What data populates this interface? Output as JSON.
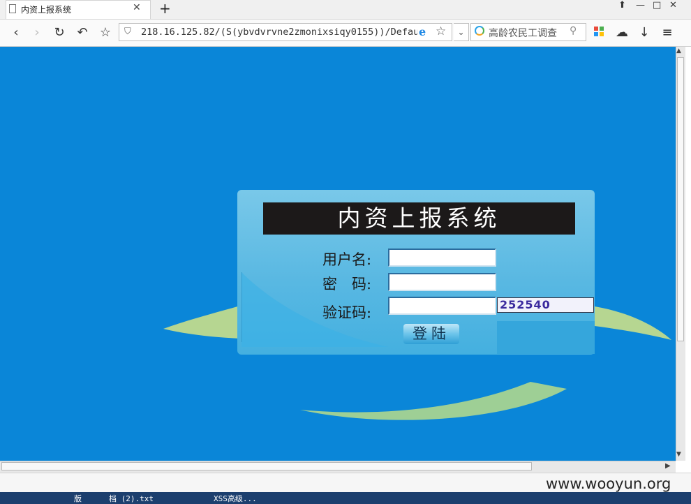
{
  "browser": {
    "tab_title": "内资上报系统",
    "url": "218.16.125.82/(S(ybvdvrvne2zmonixsiqy0155))/Defau",
    "search_text": "高龄农民工调查"
  },
  "login": {
    "title": "内资上报系统",
    "username_label": "用户名:",
    "password_label": "密　码:",
    "captcha_label": "验证码:",
    "captcha_value": "252540",
    "submit_label": "登陆"
  },
  "statusbar": {
    "watermark": "www.wooyun.org"
  },
  "taskbar": {
    "items": [
      "版",
      "档 (2).txt",
      "XSS高级..."
    ]
  },
  "colors": {
    "page_background": "#0a86d8",
    "panel": "#5fbbe4",
    "title_bar": "#1c1919",
    "swoosh": "#c9df8a"
  },
  "icons": [
    "document-icon",
    "close-icon",
    "plus-icon",
    "back-icon",
    "forward-icon",
    "reload-icon",
    "undo-icon",
    "star-icon",
    "shield-icon",
    "ie-icon",
    "chevron-down-icon",
    "search-icon",
    "apps-icon",
    "cloud-icon",
    "download-icon",
    "menu-icon"
  ]
}
